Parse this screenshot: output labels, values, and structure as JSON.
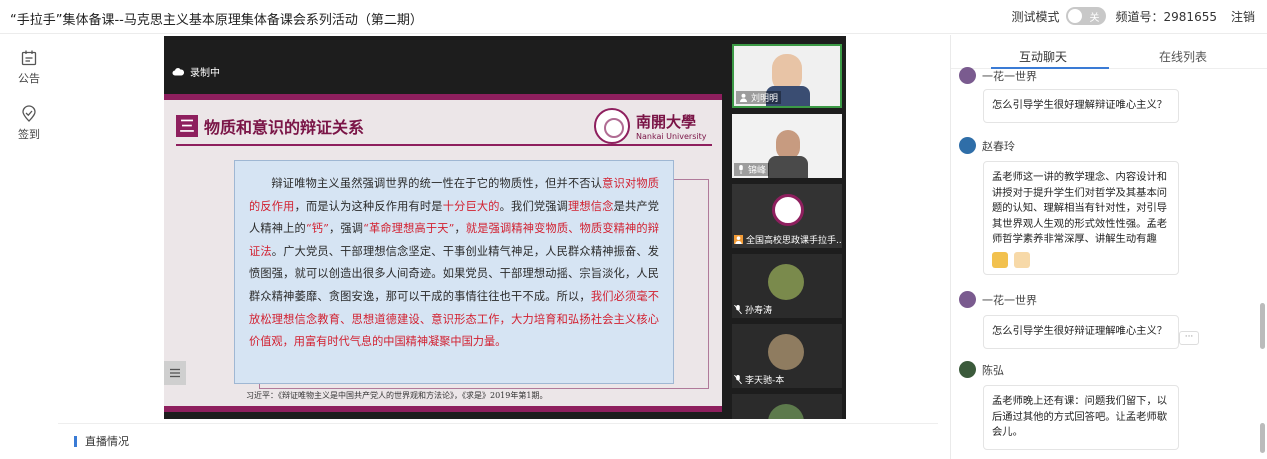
{
  "header": {
    "title": "“手拉手”集体备课--马克思主义基本原理集体备课会系列活动（第二期）",
    "test_mode_label": "测试模式",
    "toggle_label": "关",
    "channel_label": "频道号：2981655",
    "logout_label": "注销"
  },
  "rail": {
    "announcement": "公告",
    "checkin": "签到"
  },
  "video": {
    "recording_label": "录制中",
    "slide": {
      "number": "三",
      "heading": "物质和意识的辩证关系",
      "university_cn": "南開大學",
      "university_en": "Nankai University",
      "body_parts": [
        {
          "t": "辩证唯物主义虽然强调世界的统一性在于它的物质性，但并不否认",
          "red": false
        },
        {
          "t": "意识对物质的反作用",
          "red": true
        },
        {
          "t": "，而是认为这种反作用有时是",
          "red": false
        },
        {
          "t": "十分巨大的",
          "red": true
        },
        {
          "t": "。我们党强调",
          "red": false
        },
        {
          "t": "理想信念",
          "red": true
        },
        {
          "t": "是共产党人精神上的",
          "red": false
        },
        {
          "t": "“钙”",
          "red": true
        },
        {
          "t": "，强调",
          "red": false
        },
        {
          "t": "“革命理想高于天”",
          "red": true
        },
        {
          "t": "，",
          "red": false
        },
        {
          "t": "就是强调精神变物质、物质变精神的辩证法",
          "red": true
        },
        {
          "t": "。广大党员、干部理想信念坚定、干事创业精气神足，人民群众精神振奋、发愤图强，就可以创造出很多人间奇迹。如果党员、干部理想动摇、宗旨淡化，人民群众精神萎靡、贪图安逸，那可以干成的事情往往也干不成。所以，",
          "red": false
        },
        {
          "t": "我们必须毫不放松理想信念教育、思想道德建设、意识形态工作，大力培育和弘扬社会主义核心价值观，用富有时代气息的中国精神凝聚中国力量。",
          "red": true
        }
      ],
      "citation": "习近平：《辩证唯物主义是中国共产党人的世界观和方法论》，《求是》2019年第1期。"
    },
    "participants": [
      {
        "name": "刘明明",
        "icon": "user-icon"
      },
      {
        "name": "锦峰",
        "icon": "mic-icon"
      },
      {
        "name": "全国高校思政课手拉手...",
        "icon": "user-icon"
      },
      {
        "name": "孙寿涛",
        "icon": "mic-off-icon"
      },
      {
        "name": "李天驰-本",
        "icon": "mic-off-icon"
      }
    ]
  },
  "bottom": {
    "live_info_label": "直播情况"
  },
  "chat": {
    "tabs": [
      "互动聊天",
      "在线列表"
    ],
    "messages": [
      {
        "user": "一花一世界",
        "text": "怎么引导学生很好理解辩证唯心主义？"
      },
      {
        "user": "赵春玲",
        "text": "孟老师这一讲的教学理念、内容设计和讲授对于提升学生们对哲学及其基本问题的认知、理解相当有针对性，对引导其世界观人生观的形式效性性强。孟老师哲学素养非常深厚、讲解生动有趣"
      },
      {
        "user": "一花一世界",
        "text": "怎么引导学生很好辩证理解唯心主义？"
      },
      {
        "user": "陈弘",
        "text": "孟老师晚上还有课：问题我们留下，以后通过其他的方式回答吧。让孟老师歇会儿。"
      }
    ],
    "more_label": "···"
  }
}
